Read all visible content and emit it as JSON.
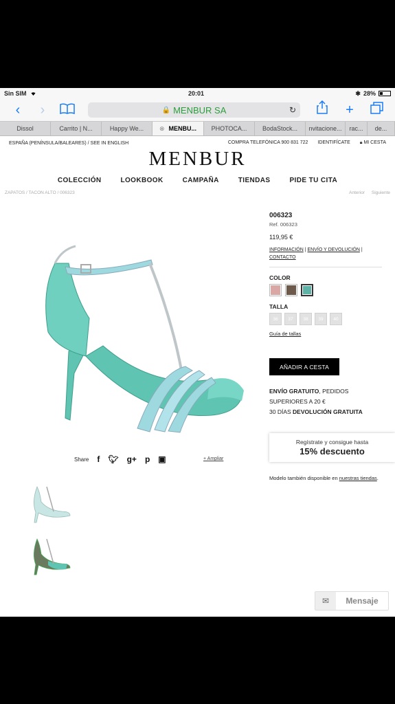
{
  "status": {
    "carrier": "Sin SIM",
    "time": "20:01",
    "battery": "28%",
    "battery_level": 0.28
  },
  "browser": {
    "url_text": "MENBUR SA",
    "tabs": [
      {
        "label": "Dissol"
      },
      {
        "label": "Carrito | N..."
      },
      {
        "label": "Happy We..."
      },
      {
        "label": "MENBU...",
        "active": true
      },
      {
        "label": "PHOTOCA..."
      },
      {
        "label": "BodaStock..."
      },
      {
        "label": "nvitacione..."
      },
      {
        "label": "rac..."
      },
      {
        "label": "de..."
      }
    ]
  },
  "site": {
    "top_left": "ESPAÑA (PENÍNSULA/BALEARES) / SEE IN ENGLISH",
    "top_phone": "COMPRA TELEFÓNICA 900 831 722",
    "top_login": "IDENTIFÍCATE",
    "top_cart": "MI CESTA",
    "logo": "MENBUR",
    "nav": [
      "COLECCIÓN",
      "LOOKBOOK",
      "CAMPAÑA",
      "TIENDAS",
      "PIDE TU CITA"
    ],
    "breadcrumb": "ZAPATOS / TACON ALTO / 006323",
    "prev": "Anterior",
    "next": "Siguiente"
  },
  "product": {
    "name": "006323",
    "ref": "Ref. 006323",
    "price": "119,95 €",
    "link_info": "INFORMACIÓN",
    "link_envio": "ENVÍO Y DEVOLUCIÓN",
    "link_contacto": "CONTACTO",
    "sep": "|",
    "color_label": "COLOR",
    "colors": [
      "#d9a8a4",
      "#6d5a4b",
      "#5fb3a6"
    ],
    "size_label": "TALLA",
    "sizes": [
      "36",
      "37",
      "38",
      "39",
      "40"
    ],
    "size_guide": "Guía de tallas",
    "add_button": "AÑADIR A CESTA",
    "ship_1_bold": "ENVÍO GRATUITO",
    "ship_1_rest": ", PEDIDOS",
    "ship_2": "SUPERIORES A 20 €",
    "ship_3_pre": "30 DÍAS ",
    "ship_3_bold": "DEVOLUCIÓN GRATUITA",
    "share": "Share",
    "zoom": "+ Ampliar",
    "availability_pre": "Modelo también disponible en ",
    "availability_link": "nuestras tiendas",
    "availability_post": "."
  },
  "promo": {
    "line1": "Regístrate y consigue hasta",
    "line2": "15% descuento"
  },
  "message_button": "Mensaje",
  "colors": {
    "accent": "#1a7cf5",
    "secure": "#2b9e3c",
    "shoe": "#5fc4b2"
  }
}
